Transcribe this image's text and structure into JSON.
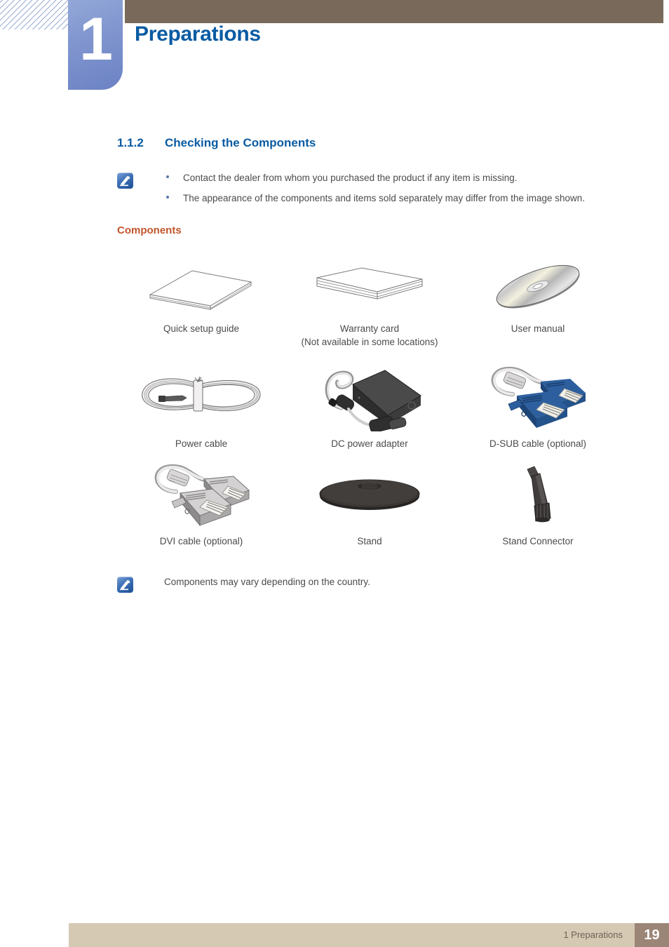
{
  "header": {
    "chapter_number": "1",
    "chapter_title": "Preparations",
    "accent_blue": "#0a5ba3",
    "badge_blue": "#8398d0",
    "bar_brown": "#78695a"
  },
  "section": {
    "number": "1.1.2",
    "title": "Checking the Components"
  },
  "note_top": {
    "icon": "note-pencil-icon",
    "bullets": [
      "Contact the dealer from whom you purchased the product if any item is missing.",
      "The appearance of the components and items sold separately may differ from the image shown."
    ]
  },
  "components_label": "Components",
  "components": [
    [
      {
        "icon": "quick-setup-guide-booklet-icon",
        "caption": "Quick setup guide",
        "caption2": ""
      },
      {
        "icon": "warranty-card-booklet-icon",
        "caption": "Warranty card",
        "caption2": "(Not available in some locations)"
      },
      {
        "icon": "user-manual-cd-icon",
        "caption": "User manual",
        "caption2": ""
      }
    ],
    [
      {
        "icon": "power-cable-icon",
        "caption": "Power cable",
        "caption2": ""
      },
      {
        "icon": "dc-power-adapter-icon",
        "caption": "DC power adapter",
        "caption2": ""
      },
      {
        "icon": "d-sub-cable-icon",
        "caption": "D-SUB cable (optional)",
        "caption2": ""
      }
    ],
    [
      {
        "icon": "dvi-cable-icon",
        "caption": "DVI cable (optional)",
        "caption2": ""
      },
      {
        "icon": "stand-base-icon",
        "caption": "Stand",
        "caption2": ""
      },
      {
        "icon": "stand-connector-icon",
        "caption": "Stand Connector",
        "caption2": ""
      }
    ]
  ],
  "note_bottom": {
    "icon": "note-pencil-icon",
    "text": "Components may vary depending on the country."
  },
  "footer": {
    "chapter_label": "1 Preparations",
    "page_number": "19",
    "bar_color": "#d6c9b4",
    "page_box_color": "#9b8577"
  }
}
